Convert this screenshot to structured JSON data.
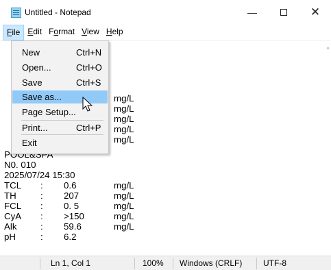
{
  "window": {
    "title": "Untitled - Notepad",
    "controls": {
      "minimize": "—",
      "close": "✕"
    },
    "icon": "notepad-icon"
  },
  "menubar": {
    "items": [
      {
        "label": "File",
        "accel": "F",
        "rest": "ile"
      },
      {
        "label": "Edit",
        "accel": "E",
        "rest": "dit"
      },
      {
        "label": "Format",
        "pre": "F",
        "accel": "o",
        "rest": "rmat"
      },
      {
        "label": "View",
        "accel": "V",
        "rest": "iew"
      },
      {
        "label": "Help",
        "accel": "H",
        "rest": "elp"
      }
    ],
    "active": "File"
  },
  "file_menu": {
    "items": [
      {
        "label": "New",
        "shortcut": "Ctrl+N"
      },
      {
        "label": "Open...",
        "shortcut": "Ctrl+O"
      },
      {
        "label": "Save",
        "shortcut": "Ctrl+S"
      },
      {
        "label": "Save as...",
        "shortcut": ""
      },
      {
        "label": "Page Setup...",
        "shortcut": ""
      },
      {
        "label": "Print...",
        "shortcut": "Ctrl+P"
      },
      {
        "label": "Exit",
        "shortcut": ""
      }
    ],
    "highlighted": "Save as..."
  },
  "editor": {
    "partial_units": [
      "mg/L",
      "mg/L",
      "mg/L",
      "mg/L",
      "mg/L"
    ],
    "header_lines": [
      "POOL&SPA",
      "N0. 010",
      "2025/07/24 15:30"
    ],
    "rows": [
      {
        "name": "TCL",
        "sep": ":",
        "value": "0.6",
        "unit": "mg/L"
      },
      {
        "name": "TH",
        "sep": ":",
        "value": "207",
        "unit": "mg/L"
      },
      {
        "name": "FCL",
        "sep": ":",
        "value": "0. 5",
        "unit": "mg/L"
      },
      {
        "name": "CyA",
        "sep": ":",
        "value": ">150",
        "unit": "mg/L"
      },
      {
        "name": "Alk",
        "sep": ":",
        "value": "59.6",
        "unit": "mg/L"
      },
      {
        "name": "pH",
        "sep": ":",
        "value": "6.2",
        "unit": ""
      }
    ]
  },
  "statusbar": {
    "position": "Ln 1, Col 1",
    "zoom": "100%",
    "line_endings": "Windows (CRLF)",
    "encoding": "UTF-8"
  }
}
